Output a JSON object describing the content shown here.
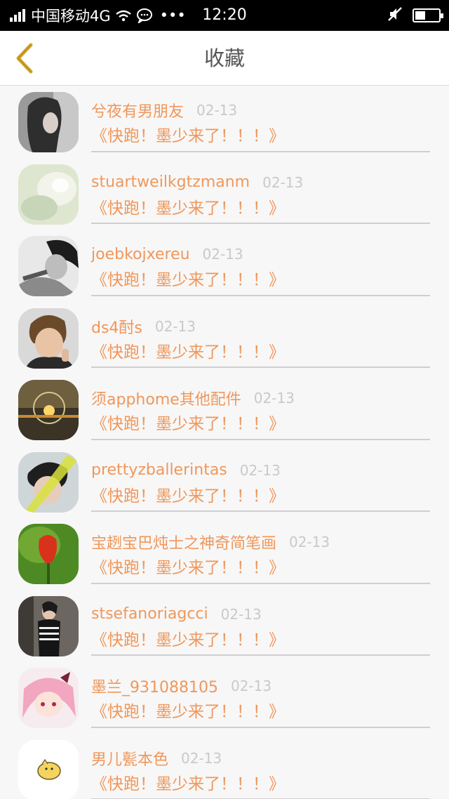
{
  "status_bar": {
    "carrier": "中国移动4G",
    "more": "•••",
    "time": "12:20"
  },
  "header": {
    "title": "收藏"
  },
  "colors": {
    "accent": "#f0975a",
    "date": "#c9c9c9",
    "back_icon": "#d4a52a"
  },
  "items": [
    {
      "user": "兮夜有男朋友",
      "date": "02-13",
      "title": "《快跑！墨少来了！！！》",
      "avatar": "girl-dark-hair"
    },
    {
      "user": "stuartweilkgtzmanm",
      "date": "02-13",
      "title": "《快跑！墨少来了！！！》",
      "avatar": "pale-blur"
    },
    {
      "user": "joebkojxereu",
      "date": "02-13",
      "title": "《快跑！墨少来了！！！》",
      "avatar": "bw-portrait"
    },
    {
      "user": "ds4酎s",
      "date": "02-13",
      "title": "《快跑！墨少来了！！！》",
      "avatar": "child"
    },
    {
      "user": "须apphome其他配件",
      "date": "02-13",
      "title": "《快跑！墨少来了！！！》",
      "avatar": "sunset-bulb"
    },
    {
      "user": "prettyzballerintas",
      "date": "02-13",
      "title": "《快跑！墨少来了！！！》",
      "avatar": "boy-yellow-stripe"
    },
    {
      "user": "宝趔宝巴炖士之神奇简笔画",
      "date": "02-13",
      "title": "《快跑！墨少来了！！！》",
      "avatar": "red-tulip"
    },
    {
      "user": "stsefanoriagcci",
      "date": "02-13",
      "title": "《快跑！墨少来了！！！》",
      "avatar": "woman-striped"
    },
    {
      "user": "墨兰_931088105",
      "date": "02-13",
      "title": "《快跑！墨少来了！！！》",
      "avatar": "anime-pink"
    },
    {
      "user": "男儿甏本色",
      "date": "02-13",
      "title": "《快跑！墨少来了！！！》",
      "avatar": "cartoon-chick"
    }
  ]
}
